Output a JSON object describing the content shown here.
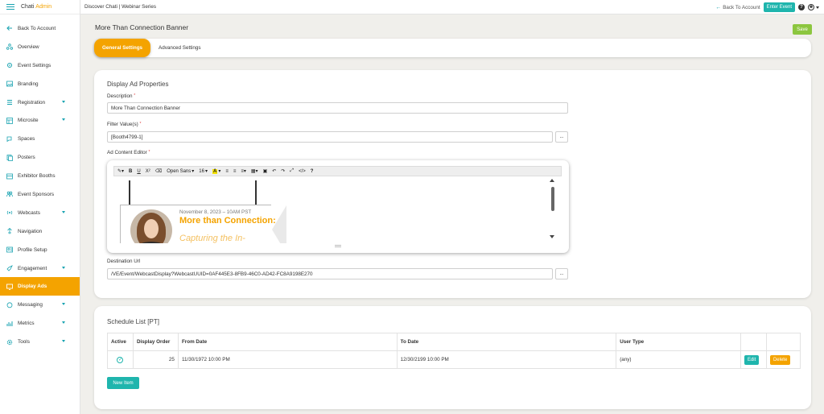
{
  "brand": {
    "name": "Chati",
    "accent": "Admin"
  },
  "sidebar": {
    "items": [
      {
        "label": "Back To Account",
        "icon": "arrow-left-icon"
      },
      {
        "label": "Overview",
        "icon": "org-chart-icon"
      },
      {
        "label": "Event Settings",
        "icon": "settings-icon"
      },
      {
        "label": "Branding",
        "icon": "image-icon"
      },
      {
        "label": "Registration",
        "icon": "list-icon",
        "expandable": true
      },
      {
        "label": "Microsite",
        "icon": "grid-icon",
        "expandable": true
      },
      {
        "label": "Spaces",
        "icon": "chat-icon"
      },
      {
        "label": "Posters",
        "icon": "poster-icon"
      },
      {
        "label": "Exhibitor Booths",
        "icon": "booth-icon"
      },
      {
        "label": "Event Sponsors",
        "icon": "users-icon"
      },
      {
        "label": "Webcasts",
        "icon": "broadcast-icon",
        "expandable": true
      },
      {
        "label": "Navigation",
        "icon": "navigation-icon"
      },
      {
        "label": "Profile Setup",
        "icon": "profile-icon"
      },
      {
        "label": "Engagement",
        "icon": "rocket-icon",
        "expandable": true
      },
      {
        "label": "Display Ads",
        "icon": "display-icon",
        "active": true
      },
      {
        "label": "Messaging",
        "icon": "message-icon",
        "expandable": true
      },
      {
        "label": "Metrics",
        "icon": "chart-icon",
        "expandable": true
      },
      {
        "label": "Tools",
        "icon": "gear-icon",
        "expandable": true
      }
    ]
  },
  "topbar": {
    "breadcrumb": "Discover Chati | Webinar Series",
    "back_label": "Back To Account",
    "enter_label": "Enter Event",
    "help": "?"
  },
  "page": {
    "title": "More Than Connection Banner",
    "save_label": "Save",
    "tabs": [
      {
        "label": "General Settings",
        "active": true
      },
      {
        "label": "Advanced Settings",
        "active": false
      }
    ]
  },
  "props": {
    "heading": "Display Ad Properties",
    "description_label": "Description",
    "description_value": "More Than Connection Banner",
    "filter_label": "Filter Value(s)",
    "filter_value": "[Booth4799-1]",
    "dots": "...",
    "editor_label": "Ad Content Editor",
    "required": "*",
    "toolbar": {
      "font": "Open Sans",
      "size": "16",
      "highlight": "A"
    },
    "banner": {
      "date": "November 8, 2023 – 10AM PST",
      "title": "More than Connection:",
      "subtitle": "Capturing the In-Person"
    },
    "destination_label": "Destination Url",
    "destination_value": "/VE/Event/WebcastDisplay?WebcastUUID=0AF445E3-8FB9-46C0-AD42-FC8A9198E270"
  },
  "schedule": {
    "heading": "Schedule List [PT]",
    "columns": [
      "Active",
      "Display Order",
      "From Date",
      "To Date",
      "User Type",
      "",
      ""
    ],
    "rows": [
      {
        "order": "25",
        "from": "11/30/1972 10:00 PM",
        "to": "12/30/2199 10:00 PM",
        "user_type": "(any)",
        "edit": "Edit",
        "delete": "Delete"
      }
    ],
    "new_item": "New Item"
  },
  "colors": {
    "accent": "#f4a300",
    "teal": "#1fb5ad",
    "save": "#8cc63f"
  }
}
